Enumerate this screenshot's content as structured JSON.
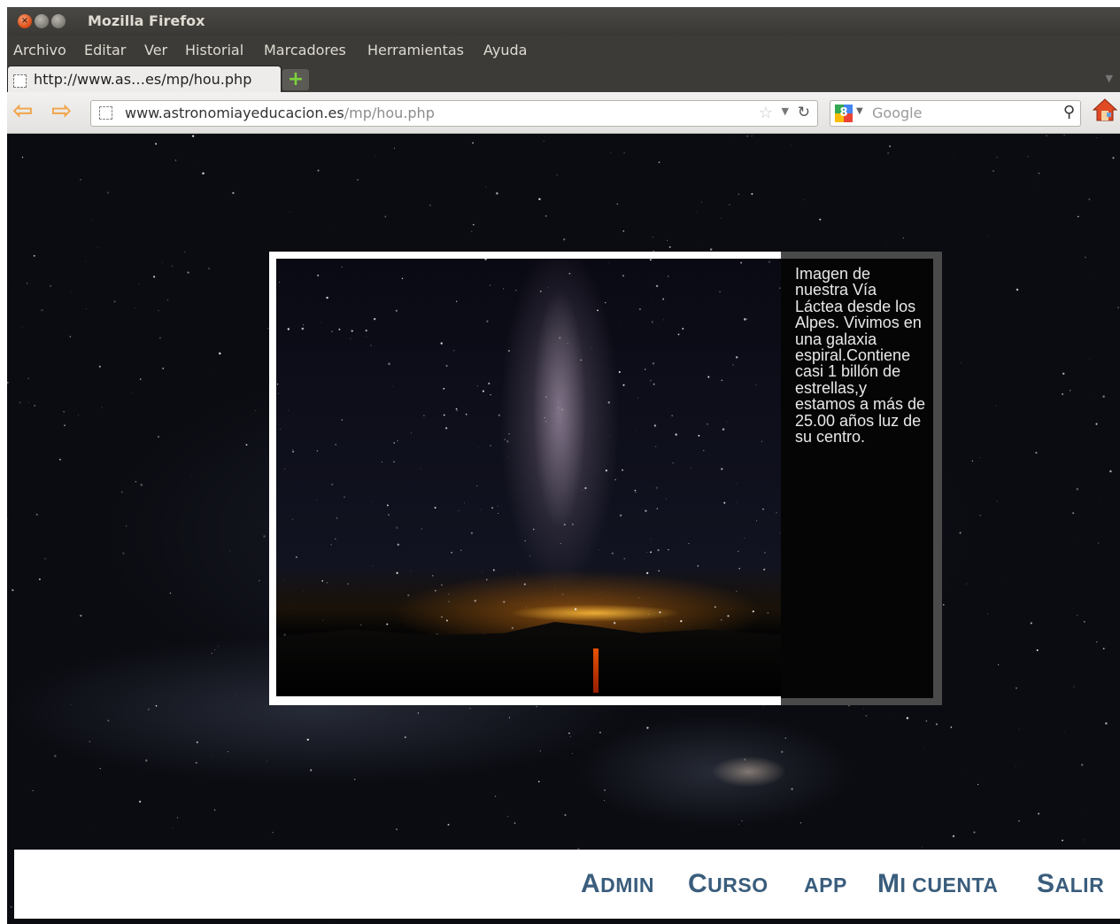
{
  "window": {
    "title": "Mozilla Firefox"
  },
  "menubar": {
    "items": [
      "Archivo",
      "Editar",
      "Ver",
      "Historial",
      "Marcadores",
      "Herramientas",
      "Ayuda"
    ]
  },
  "tabs": [
    {
      "label": "http://www.as…es/mp/hou.php"
    }
  ],
  "navbar": {
    "url_domain": "www.astronomiayeducacion.es",
    "url_path": "/mp/hou.php",
    "search_placeholder": "Google"
  },
  "content": {
    "caption": "Imagen de nuestra Vía Láctea desde los Alpes. Vivimos en una galaxia espiral.Contiene casi 1 billón de estrellas,y estamos a más de 25.00 años luz de su centro."
  },
  "footer_nav": [
    {
      "first": "A",
      "rest": "DMIN"
    },
    {
      "first": "C",
      "rest": "URSO"
    },
    {
      "first": "",
      "rest": "APP"
    },
    {
      "first": "M",
      "rest": "I CUENTA"
    },
    {
      "first": "S",
      "rest": "ALIR"
    }
  ],
  "colors": {
    "nav_text": "#3a5d7c",
    "chrome_dark": "#3c3b37",
    "close_button": "#e0531c",
    "arrow": "#f0a54a"
  }
}
